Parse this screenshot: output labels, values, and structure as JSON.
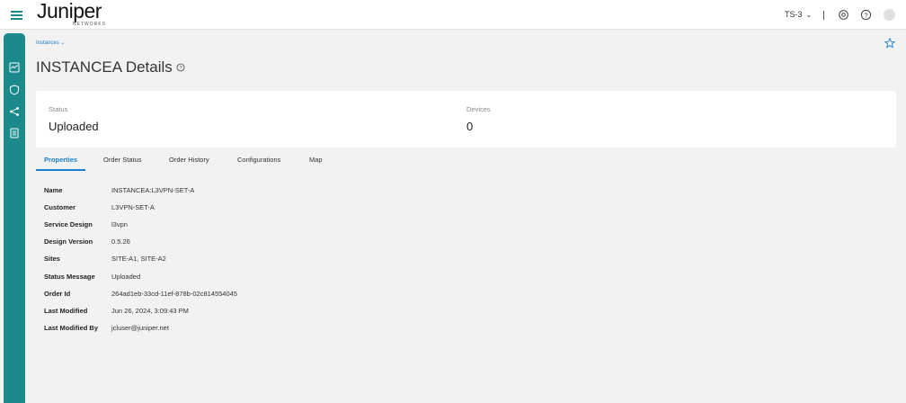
{
  "header": {
    "logo_text": "JUNIPER",
    "logo_subtext": "NETWORKS",
    "tenant": "TS-3"
  },
  "sidebar": {
    "items": [
      {
        "icon": "dashboard-icon"
      },
      {
        "icon": "shield-icon"
      },
      {
        "icon": "network-share-icon"
      },
      {
        "icon": "document-icon"
      }
    ]
  },
  "breadcrumb": {
    "label": "Instances"
  },
  "page": {
    "title": "INSTANCEA Details"
  },
  "summary": {
    "status_label": "Status",
    "status_value": "Uploaded",
    "devices_label": "Devices",
    "devices_value": "0"
  },
  "tabs": [
    {
      "label": "Properties",
      "active": true
    },
    {
      "label": "Order Status",
      "active": false
    },
    {
      "label": "Order History",
      "active": false
    },
    {
      "label": "Configurations",
      "active": false
    },
    {
      "label": "Map",
      "active": false
    }
  ],
  "properties": [
    {
      "label": "Name",
      "value": "INSTANCEA:L3VPN-SET-A"
    },
    {
      "label": "Customer",
      "value": "L3VPN-SET-A"
    },
    {
      "label": "Service Design",
      "value": "l3vpn"
    },
    {
      "label": "Design Version",
      "value": "0.5.26"
    },
    {
      "label": "Sites",
      "value": "SITE-A1, SITE-A2"
    },
    {
      "label": "Status Message",
      "value": "Uploaded"
    },
    {
      "label": "Order Id",
      "value": "264ad1eb-33cd-11ef-878b-02c814554045"
    },
    {
      "label": "Last Modified",
      "value": "Jun 26, 2024, 3:09:43 PM"
    },
    {
      "label": "Last Modified By",
      "value": "jcluser@juniper.net"
    }
  ],
  "colors": {
    "accent": "#1a8a8a",
    "link": "#1a7fd0"
  }
}
